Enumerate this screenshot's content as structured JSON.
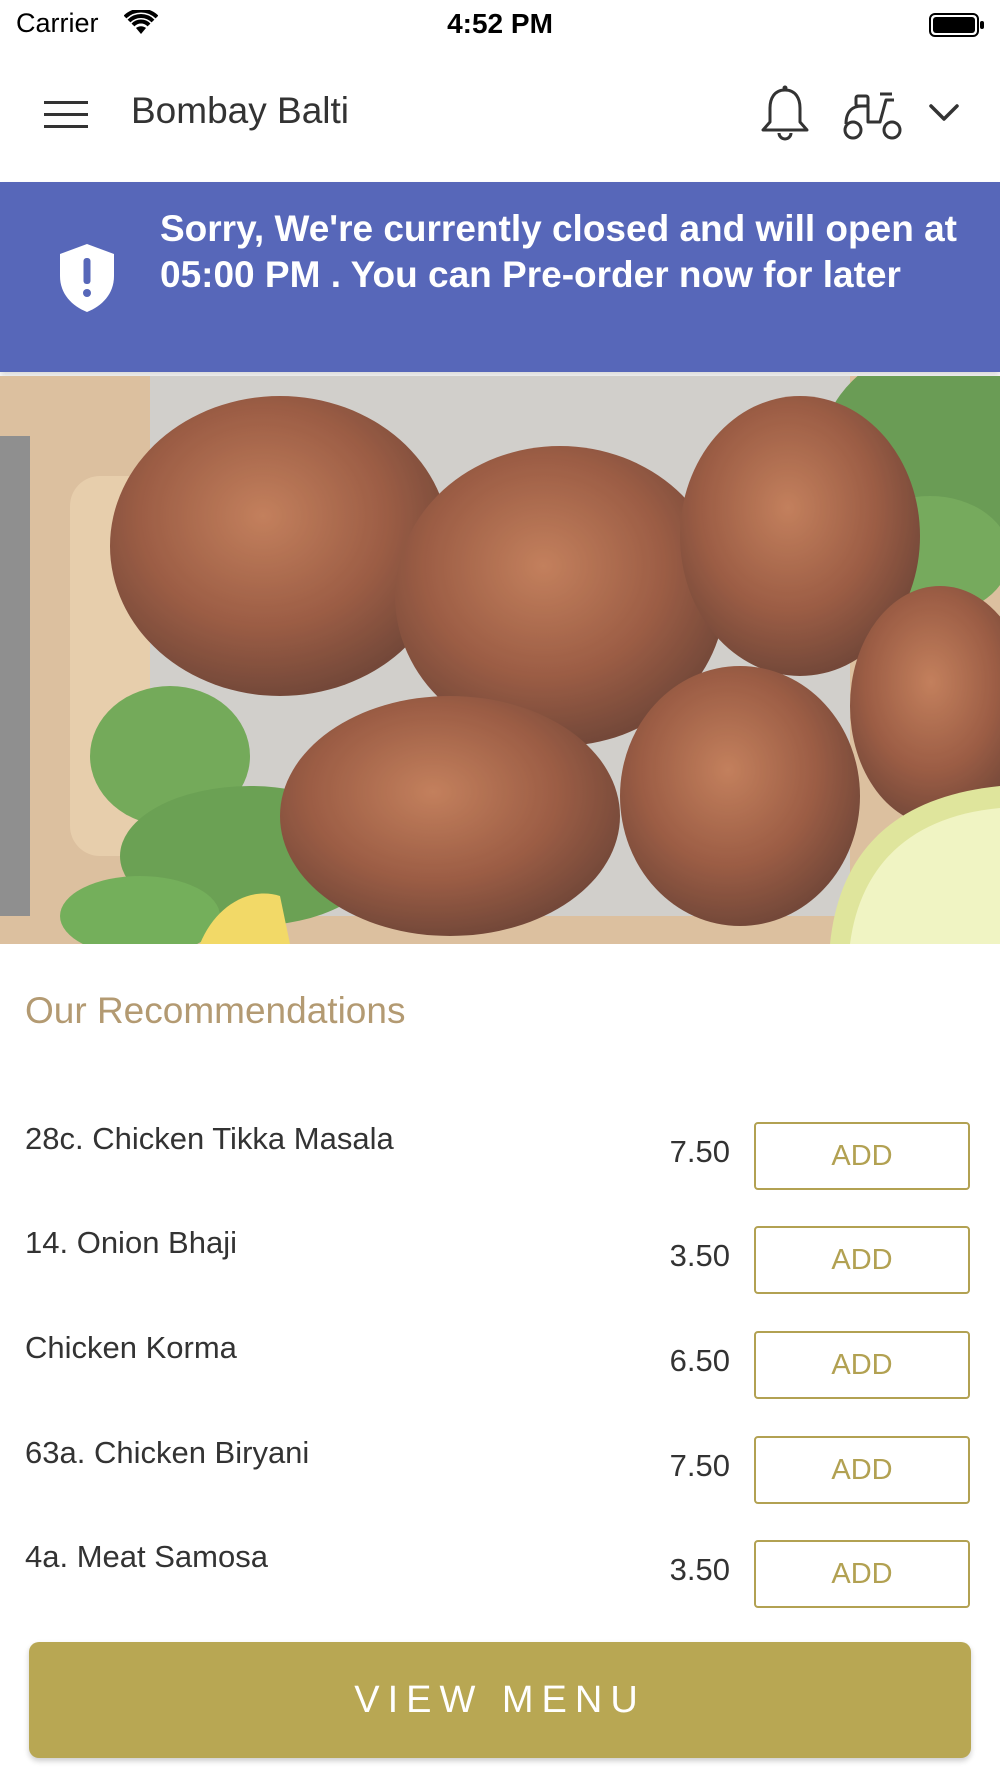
{
  "status_bar": {
    "carrier": "Carrier",
    "time": "4:52 PM"
  },
  "header": {
    "title": "Bombay Balti"
  },
  "notice": {
    "message": "Sorry, We're currently closed and will open at 05:00 PM . You can Pre-order now for later"
  },
  "recommendations": {
    "title": "Our Recommendations",
    "add_label": "ADD",
    "items": [
      {
        "name": "28c. Chicken Tikka Masala",
        "price": "7.50"
      },
      {
        "name": "14. Onion Bhaji",
        "price": "3.50"
      },
      {
        "name": "Chicken Korma",
        "price": "6.50"
      },
      {
        "name": "63a. Chicken Biryani",
        "price": "7.50"
      },
      {
        "name": "4a. Meat Samosa",
        "price": "3.50"
      }
    ]
  },
  "footer": {
    "view_menu_label": "VIEW MENU"
  },
  "colors": {
    "notice_bg": "#5767b9",
    "accent_gold": "#b8a753",
    "recommendation_title": "#b39a72"
  },
  "icons": [
    "menu-icon",
    "bell-icon",
    "scooter-icon",
    "chevron-down-icon",
    "shield-alert-icon",
    "wifi-icon",
    "battery-icon"
  ]
}
